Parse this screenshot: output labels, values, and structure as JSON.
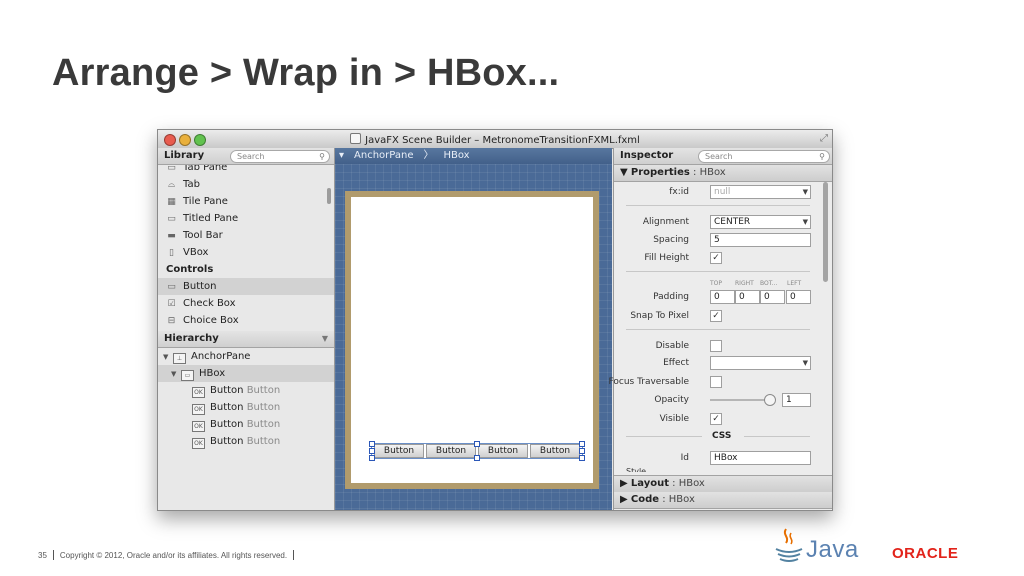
{
  "slide": {
    "title": "Arrange > Wrap in > HBox...",
    "page_number": "35",
    "copyright": "Copyright © 2012, Oracle and/or its affiliates. All rights reserved.",
    "java_brand": "Java",
    "oracle_brand": "ORACLE"
  },
  "window": {
    "title": "JavaFX Scene Builder – MetronomeTransitionFXML.fxml"
  },
  "library": {
    "header": "Library",
    "search_placeholder": "Search",
    "items": [
      {
        "label": "Tab Pane",
        "icon": "tab-pane-icon"
      },
      {
        "label": "Tab",
        "icon": "tab-icon"
      },
      {
        "label": "Tile Pane",
        "icon": "tile-pane-icon"
      },
      {
        "label": "Titled Pane",
        "icon": "titled-pane-icon"
      },
      {
        "label": "Tool Bar",
        "icon": "toolbar-icon"
      },
      {
        "label": "VBox",
        "icon": "vbox-icon"
      }
    ],
    "category": "Controls",
    "control_items": [
      {
        "label": "Button",
        "icon": "button-icon"
      },
      {
        "label": "Check Box",
        "icon": "checkbox-icon"
      },
      {
        "label": "Choice Box",
        "icon": "choicebox-icon"
      }
    ]
  },
  "hierarchy": {
    "header": "Hierarchy",
    "root": "AnchorPane",
    "hbox": "HBox",
    "buttons": [
      {
        "label": "Button",
        "sub": "Button"
      },
      {
        "label": "Button",
        "sub": "Button"
      },
      {
        "label": "Button",
        "sub": "Button"
      },
      {
        "label": "Button",
        "sub": "Button"
      }
    ]
  },
  "breadcrumb": [
    "AnchorPane",
    "HBox"
  ],
  "canvas": {
    "buttons": [
      "Button",
      "Button",
      "Button",
      "Button"
    ]
  },
  "inspector": {
    "header": "Inspector",
    "search_placeholder": "Search",
    "properties_label": "Properties",
    "properties_target": "HBox",
    "fx_id_label": "fx:id",
    "fx_id_placeholder": "null",
    "alignment_label": "Alignment",
    "alignment_value": "CENTER",
    "spacing_label": "Spacing",
    "spacing_value": "5",
    "fill_height_label": "Fill Height",
    "fill_height_checked": "✓",
    "padding_label": "Padding",
    "padding_headers": [
      "TOP",
      "RIGHT",
      "BOT...",
      "LEFT"
    ],
    "padding_values": [
      "0",
      "0",
      "0",
      "0"
    ],
    "snap_label": "Snap To Pixel",
    "snap_checked": "✓",
    "disable_label": "Disable",
    "effect_label": "Effect",
    "focus_label": "Focus Traversable",
    "opacity_label": "Opacity",
    "opacity_value": "1",
    "visible_label": "Visible",
    "visible_checked": "✓",
    "css_label": "CSS",
    "id_label": "Id",
    "id_value": "HBox",
    "style_label": "Style",
    "layout_label": "Layout",
    "layout_target": "HBox",
    "code_label": "Code",
    "code_target": "HBox"
  }
}
